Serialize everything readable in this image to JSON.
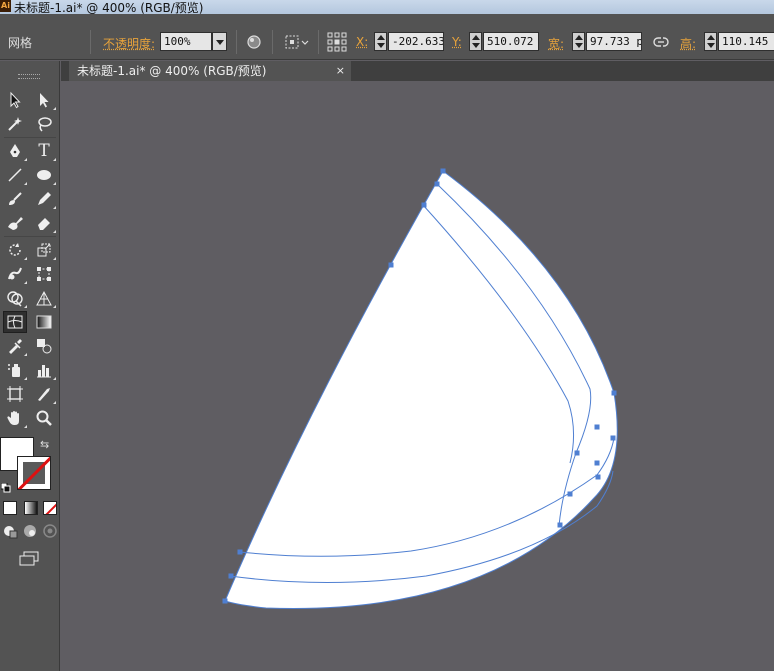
{
  "window": {
    "app_logo": "Ai",
    "title": "未标题-1.ai* @ 400% (RGB/预览)"
  },
  "control_bar": {
    "object_type": "网格",
    "opacity_label": "不透明度:",
    "opacity_value": "100%",
    "x_label": "X:",
    "x_value": "-202.633",
    "y_label": "Y:",
    "y_value": "510.072",
    "width_label": "宽:",
    "width_value": "97.733 p",
    "height_label": "高:",
    "height_value": "110.145"
  },
  "document_tab": {
    "label": "未标题-1.ai* @ 400% (RGB/预览)",
    "close": "×"
  },
  "tools": {
    "type_tool_glyph": "T",
    "swap_glyph": "⇆"
  },
  "colors": {
    "canvas_bg": "#5f5d62",
    "panel_bg": "#535353",
    "mesh_line": "#4f7fd1",
    "shape_fill": "#ffffff",
    "accent_label": "#e8a33b"
  }
}
